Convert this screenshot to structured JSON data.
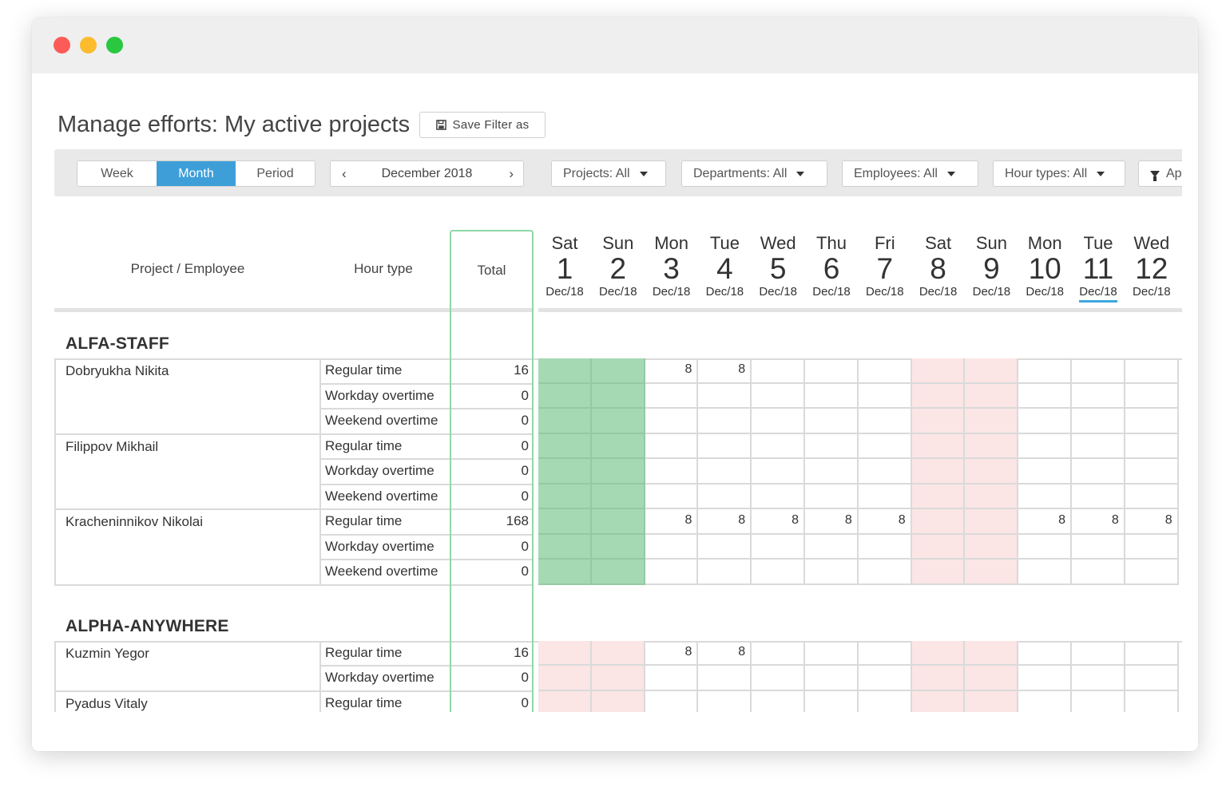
{
  "title": "Manage efforts: My active projects",
  "save_filter_label": "Save Filter as",
  "view_tabs": [
    "Week",
    "Month",
    "Period"
  ],
  "active_tab": "Month",
  "period_label": "December 2018",
  "prev_icon": "‹",
  "next_icon": "›",
  "filters": {
    "projects": "Projects: All",
    "departments": "Departments: All",
    "employees": "Employees: All",
    "hour_types": "Hour types: All",
    "apply": "Ap"
  },
  "columns": {
    "project_employee": "Project / Employee",
    "hour_type": "Hour type",
    "total": "Total"
  },
  "days": [
    {
      "dow": "Sat",
      "num": "1",
      "mon": "Dec/18"
    },
    {
      "dow": "Sun",
      "num": "2",
      "mon": "Dec/18"
    },
    {
      "dow": "Mon",
      "num": "3",
      "mon": "Dec/18"
    },
    {
      "dow": "Tue",
      "num": "4",
      "mon": "Dec/18"
    },
    {
      "dow": "Wed",
      "num": "5",
      "mon": "Dec/18"
    },
    {
      "dow": "Thu",
      "num": "6",
      "mon": "Dec/18"
    },
    {
      "dow": "Fri",
      "num": "7",
      "mon": "Dec/18"
    },
    {
      "dow": "Sat",
      "num": "8",
      "mon": "Dec/18"
    },
    {
      "dow": "Sun",
      "num": "9",
      "mon": "Dec/18"
    },
    {
      "dow": "Mon",
      "num": "10",
      "mon": "Dec/18"
    },
    {
      "dow": "Tue",
      "num": "11",
      "mon": "Dec/18",
      "today": true
    },
    {
      "dow": "Wed",
      "num": "12",
      "mon": "Dec/18"
    }
  ],
  "groups": [
    {
      "name": "ALFA-STAFF",
      "employees": [
        {
          "name": "Dobryukha Nikita",
          "rows": [
            {
              "type": "Regular time",
              "total": "16",
              "cells": [
                "",
                "",
                "8",
                "8",
                "",
                "",
                "",
                "",
                "",
                "",
                "",
                ""
              ]
            },
            {
              "type": "Workday overtime",
              "total": "0",
              "cells": []
            },
            {
              "type": "Weekend overtime",
              "total": "0",
              "cells": []
            }
          ]
        },
        {
          "name": "Filippov Mikhail",
          "rows": [
            {
              "type": "Regular time",
              "total": "0",
              "cells": []
            },
            {
              "type": "Workday overtime",
              "total": "0",
              "cells": []
            },
            {
              "type": "Weekend overtime",
              "total": "0",
              "cells": []
            }
          ]
        },
        {
          "name": "Kracheninnikov Nikolai",
          "rows": [
            {
              "type": "Regular time",
              "total": "168",
              "cells": [
                "",
                "",
                "8",
                "8",
                "8",
                "8",
                "8",
                "",
                "",
                "8",
                "8",
                "8"
              ]
            },
            {
              "type": "Workday overtime",
              "total": "0",
              "cells": []
            },
            {
              "type": "Weekend overtime",
              "total": "0",
              "cells": []
            }
          ]
        }
      ]
    },
    {
      "name": "ALPHA-ANYWHERE",
      "employees": [
        {
          "name": "Kuzmin Yegor",
          "rows": [
            {
              "type": "Regular time",
              "total": "16",
              "cells": [
                "",
                "",
                "8",
                "8",
                "",
                "",
                "",
                "",
                "",
                "",
                "",
                ""
              ]
            },
            {
              "type": "Workday overtime",
              "total": "0",
              "cells": []
            }
          ]
        },
        {
          "name": "Pyadus Vitaly",
          "rows": [
            {
              "type": "Regular time",
              "total": "0",
              "cells": []
            }
          ]
        }
      ]
    }
  ],
  "colors": {
    "accent": "#3e9fd8",
    "weekend_group1": "#a5d9b4",
    "weekend_group2": "#fbe5e5",
    "weekend_default": "#fbe5e5",
    "total_outline": "#8ed8a8"
  }
}
